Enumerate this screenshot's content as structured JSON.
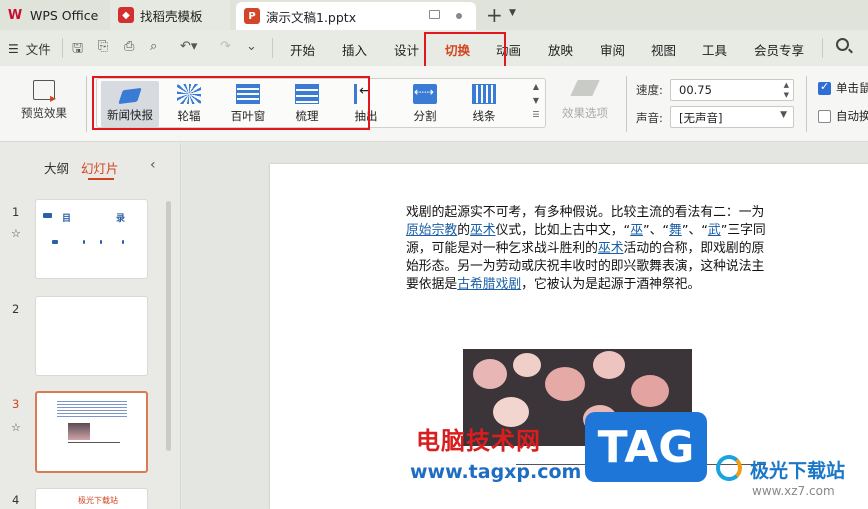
{
  "tabs": {
    "wps": "WPS Office",
    "template": "找稻壳模板",
    "doc": "演示文稿1.pptx"
  },
  "menu": {
    "file": "文件",
    "items": [
      "开始",
      "插入",
      "设计",
      "切换",
      "动画",
      "放映",
      "审阅",
      "视图",
      "工具",
      "会员专享"
    ],
    "active": "切换"
  },
  "ribbon": {
    "preview": "预览效果",
    "transitions": [
      "新闻快报",
      "轮辐",
      "百叶窗",
      "梳理",
      "抽出",
      "分割",
      "线条"
    ],
    "selected_transition": "新闻快报",
    "effect_options": "效果选项",
    "speed_label": "速度:",
    "speed_value": "00.75",
    "sound_label": "声音:",
    "sound_value": "[无声音]",
    "on_click_label": "单击鼠",
    "auto_label": "自动换"
  },
  "panel": {
    "outline_tab": "大纲",
    "slides_tab": "幻灯片",
    "slide_numbers": [
      "1",
      "2",
      "3",
      "4"
    ],
    "thumb1_title_a": "目",
    "thumb1_title_b": "录",
    "thumb4_title": "极光下载站"
  },
  "slide": {
    "p1": "戏剧的起源实不可考，有多种假说。比较主流的看法有二：一为",
    "link1": "原始宗教",
    "p2": "的",
    "link2": "巫术",
    "p3": "仪式，比如上古中文，“",
    "link3": "巫",
    "p4": "”、“",
    "link4": "舞",
    "p5": "”、“",
    "link5": "武",
    "p6": "”三字同源，可能是对一种乞求战斗胜利的",
    "link6": "巫术",
    "p7": "活动的合称，即戏剧的原始形态。另一为劳动或庆祝丰收时的即兴歌舞表演，这种说法主要依据是",
    "link7": "古希腊戏剧",
    "p8": "，它被认为是起源于酒神祭祀。"
  },
  "watermarks": {
    "site": "电脑技术网",
    "url": "www.tagxp.com",
    "tag": "TAG",
    "logo": "极光下载站",
    "logo_url": "www.xz7.com"
  }
}
